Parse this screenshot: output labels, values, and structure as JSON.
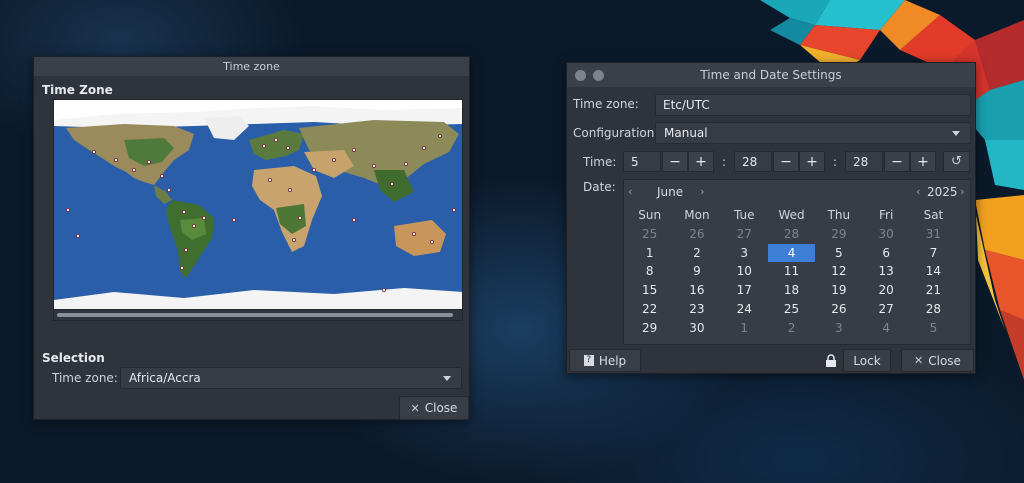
{
  "timezone_window": {
    "title": "Time zone",
    "map_heading": "Time Zone",
    "selection_heading": "Selection",
    "timezone_label": "Time zone:",
    "timezone_value": "Africa/Accra",
    "close_label": "Close"
  },
  "datetime_window": {
    "title": "Time and Date Settings",
    "timezone_label": "Time zone:",
    "timezone_value": "Etc/UTC",
    "configuration_label": "Configuration:",
    "configuration_value": "Manual",
    "time_label": "Time:",
    "hour": "5",
    "minute": "28",
    "second": "28",
    "minus": "−",
    "plus": "+",
    "colon": ":",
    "date_label": "Date:",
    "calendar": {
      "month": "June",
      "year": "2025",
      "weekdays": [
        "Sun",
        "Mon",
        "Tue",
        "Wed",
        "Thu",
        "Fri",
        "Sat"
      ],
      "weeks": [
        [
          {
            "d": "25",
            "o": true
          },
          {
            "d": "26",
            "o": true
          },
          {
            "d": "27",
            "o": true
          },
          {
            "d": "28",
            "o": true
          },
          {
            "d": "29",
            "o": true
          },
          {
            "d": "30",
            "o": true
          },
          {
            "d": "31",
            "o": true
          }
        ],
        [
          {
            "d": "1"
          },
          {
            "d": "2"
          },
          {
            "d": "3"
          },
          {
            "d": "4",
            "s": true
          },
          {
            "d": "5"
          },
          {
            "d": "6"
          },
          {
            "d": "7"
          }
        ],
        [
          {
            "d": "8"
          },
          {
            "d": "9"
          },
          {
            "d": "10"
          },
          {
            "d": "11"
          },
          {
            "d": "12"
          },
          {
            "d": "13"
          },
          {
            "d": "14"
          }
        ],
        [
          {
            "d": "15"
          },
          {
            "d": "16"
          },
          {
            "d": "17"
          },
          {
            "d": "18"
          },
          {
            "d": "19"
          },
          {
            "d": "20"
          },
          {
            "d": "21"
          }
        ],
        [
          {
            "d": "22"
          },
          {
            "d": "23"
          },
          {
            "d": "24"
          },
          {
            "d": "25"
          },
          {
            "d": "26"
          },
          {
            "d": "27"
          },
          {
            "d": "28"
          }
        ],
        [
          {
            "d": "29"
          },
          {
            "d": "30"
          },
          {
            "d": "1",
            "o": true
          },
          {
            "d": "2",
            "o": true
          },
          {
            "d": "3",
            "o": true
          },
          {
            "d": "4",
            "o": true
          },
          {
            "d": "5",
            "o": true
          }
        ]
      ]
    },
    "help_label": "Help",
    "lock_label": "Lock",
    "close_label": "Close"
  },
  "colors": {
    "accent": "#3d7fd6",
    "window_bg": "#2f333c",
    "ocean": "#2a5ea8"
  }
}
